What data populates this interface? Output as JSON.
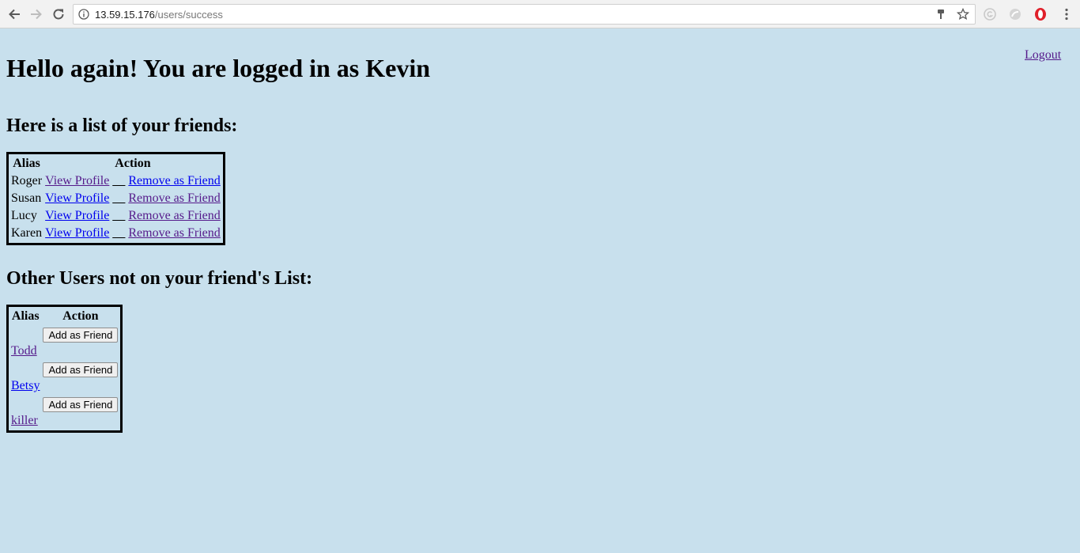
{
  "browser": {
    "url_host": "13.59.15.176",
    "url_path": "/users/success"
  },
  "page": {
    "greeting": "Hello again! You are logged in as Kevin",
    "logout_label": "Logout",
    "friends_heading": "Here is a list of your friends:",
    "others_heading": "Other Users not on your friend's List:"
  },
  "friends_table": {
    "headers": [
      "Alias",
      "Action"
    ],
    "separator": "__",
    "view_label": "View Profile",
    "remove_label": "Remove as Friend",
    "rows": [
      {
        "alias": "Roger"
      },
      {
        "alias": "Susan"
      },
      {
        "alias": "Lucy"
      },
      {
        "alias": "Karen"
      }
    ]
  },
  "others_table": {
    "headers": [
      "Alias",
      "Action"
    ],
    "add_label": "Add as Friend",
    "rows": [
      {
        "alias": "Todd"
      },
      {
        "alias": "Betsy"
      },
      {
        "alias": "killer"
      }
    ]
  }
}
